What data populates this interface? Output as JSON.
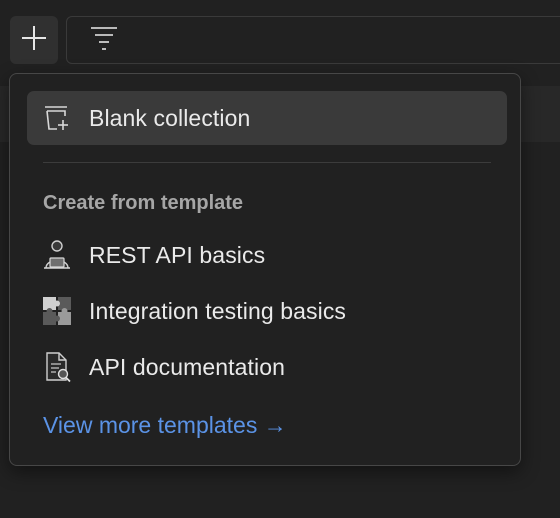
{
  "toolbar": {
    "add_icon": "plus-icon",
    "filter_icon": "filter-icon"
  },
  "menu": {
    "blank_collection": {
      "label": "Blank collection",
      "icon": "new-collection-icon"
    },
    "section_heading": "Create from template",
    "templates": [
      {
        "label": "REST API basics",
        "icon": "person-at-laptop-icon"
      },
      {
        "label": "Integration testing basics",
        "icon": "puzzle-pieces-icon"
      },
      {
        "label": "API documentation",
        "icon": "document-search-icon"
      }
    ],
    "view_more": "View more templates →"
  },
  "colors": {
    "background": "#212121",
    "menu_border": "#474747",
    "highlight": "#3a3a3a",
    "text": "#eaeaea",
    "muted_text": "#a6a6a6",
    "link": "#5b93e6"
  }
}
